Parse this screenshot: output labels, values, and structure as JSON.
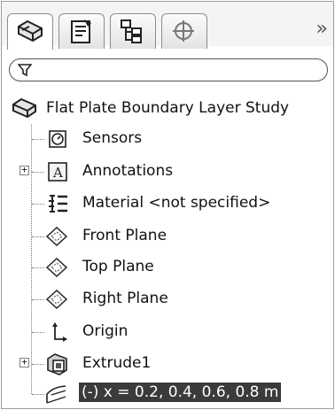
{
  "tabs": [
    {
      "name": "feature-tree-tab",
      "icon": "part-tree-icon",
      "active": true
    },
    {
      "name": "property-tab",
      "icon": "property-manager-icon",
      "active": false
    },
    {
      "name": "configuration-tab",
      "icon": "configuration-icon",
      "active": false
    },
    {
      "name": "dimxpert-tab",
      "icon": "dimxpert-icon",
      "active": false
    }
  ],
  "overflow_label": "»",
  "filter": {
    "placeholder": "",
    "icon": "filter-icon"
  },
  "tree": {
    "root": {
      "label": "Flat Plate Boundary Layer Study",
      "icon": "part-icon"
    },
    "items": [
      {
        "label": "Sensors",
        "icon": "sensors-icon",
        "expandable": false
      },
      {
        "label": "Annotations",
        "icon": "annotations-icon",
        "expandable": true
      },
      {
        "label": "Material <not specified>",
        "icon": "material-icon",
        "expandable": false
      },
      {
        "label": "Front Plane",
        "icon": "plane-icon",
        "expandable": false
      },
      {
        "label": "Top Plane",
        "icon": "plane-icon",
        "expandable": false
      },
      {
        "label": "Right Plane",
        "icon": "plane-icon",
        "expandable": false
      },
      {
        "label": "Origin",
        "icon": "origin-icon",
        "expandable": false
      },
      {
        "label": "Extrude1",
        "icon": "extrude-icon",
        "expandable": true
      },
      {
        "label": "(-) x = 0.2, 0.4, 0.6, 0.8 m",
        "icon": "sketch-icon",
        "expandable": false,
        "selected": true
      }
    ]
  },
  "colors": {
    "selection": "#3b3b3b",
    "border": "#9c9c9c"
  }
}
